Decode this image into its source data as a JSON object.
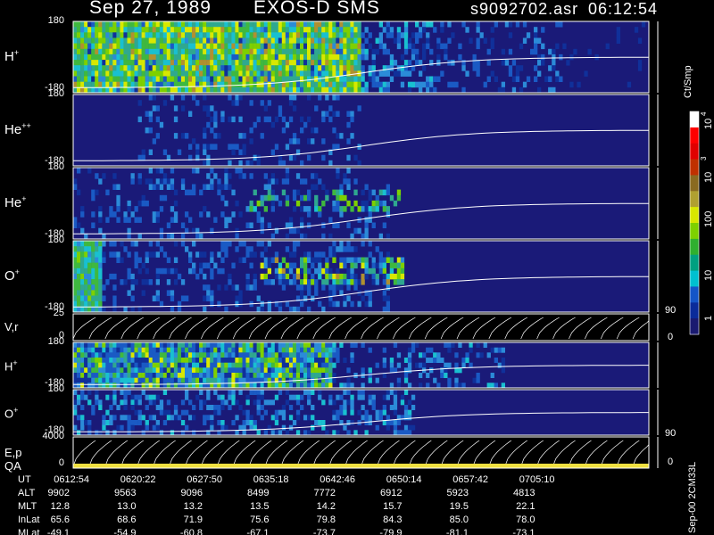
{
  "header": {
    "date": "Sep 27, 1989",
    "mission": "EXOS-D SMS",
    "filename": "s9092702.asr",
    "time": "06:12:54"
  },
  "colorbar": {
    "unit": "Ct/Smp",
    "tick_labels": [
      "1",
      "10",
      "100",
      "10",
      "3",
      "10",
      "4"
    ],
    "colors": [
      "#1a1a70",
      "#0a2b9a",
      "#1455c8",
      "#00c0d0",
      "#00a080",
      "#2fb02f",
      "#7ed000",
      "#d8e800",
      "#b0a030",
      "#8a6a20",
      "#c03000",
      "#e00000",
      "#ff0000",
      "#ffffff"
    ]
  },
  "side_labels": {
    "vr_right_top": "90",
    "vr_right_bottom": "0",
    "ep_right_top": "90",
    "ep_right_bottom": "0",
    "version": "Sep-00  2CM33L"
  },
  "footer": {
    "row_labels": [
      "UT",
      "ALT",
      "MLT",
      "InLat",
      "MLat"
    ],
    "rows": [
      [
        "0612:54",
        "0620:22",
        "0627:50",
        "0635:18",
        "0642:46",
        "0650:14",
        "0657:42",
        "0705:10"
      ],
      [
        "9902",
        "9563",
        "9096",
        "8499",
        "7772",
        "6912",
        "5923",
        "4813"
      ],
      [
        "12.8",
        "13.0",
        "13.2",
        "13.5",
        "14.2",
        "15.7",
        "19.5",
        "22.1"
      ],
      [
        "65.6",
        "68.6",
        "71.9",
        "75.6",
        "79.8",
        "84.3",
        "85.0",
        "78.0"
      ],
      [
        "-49.1",
        "-54.9",
        "-60.8",
        "-67.1",
        "-73.7",
        "-79.9",
        "-81.1",
        "-73.1"
      ]
    ]
  },
  "chart_data": [
    {
      "type": "heatmap",
      "label": "H",
      "sup": "+",
      "yticks": [
        "180",
        "-180"
      ],
      "ylim": [
        -180,
        180
      ],
      "x_range": [
        "0612:54",
        "0712:00"
      ],
      "dominant": "intense (green/yellow) then low (blue)",
      "overlay_curve": "pitch angle trace rising to ~ -30 after 0642"
    },
    {
      "type": "heatmap",
      "label": "He",
      "sup": "++",
      "yticks": [
        "180",
        "-180"
      ],
      "ylim": [
        -180,
        180
      ],
      "dominant": "low (dark blue)"
    },
    {
      "type": "heatmap",
      "label": "He",
      "sup": "+",
      "yticks": [
        "180",
        "-180"
      ],
      "ylim": [
        -180,
        180
      ],
      "dominant": "low (dark blue) with isolated spots"
    },
    {
      "type": "heatmap",
      "label": "O",
      "sup": "+",
      "yticks": [
        "180",
        "-180"
      ],
      "ylim": [
        -180,
        180
      ],
      "dominant": "low (dark blue), intense near 0640"
    },
    {
      "type": "line",
      "label": "V,r",
      "sup": "",
      "yticks": [
        "25",
        "0"
      ],
      "ylim": [
        0,
        25
      ]
    },
    {
      "type": "heatmap",
      "label": "H",
      "sup": "+",
      "yticks": [
        "180",
        "-180"
      ],
      "ylim": [
        -180,
        180
      ],
      "dominant": "banded green/cyan"
    },
    {
      "type": "heatmap",
      "label": "O",
      "sup": "+",
      "yticks": [
        "180",
        "-180"
      ],
      "ylim": [
        -180,
        180
      ],
      "dominant": "low blue"
    },
    {
      "type": "line",
      "label": "E,p",
      "label2": "QA",
      "sup": "",
      "yticks": [
        "4000",
        "0"
      ],
      "ylim": [
        0,
        4000
      ]
    }
  ]
}
